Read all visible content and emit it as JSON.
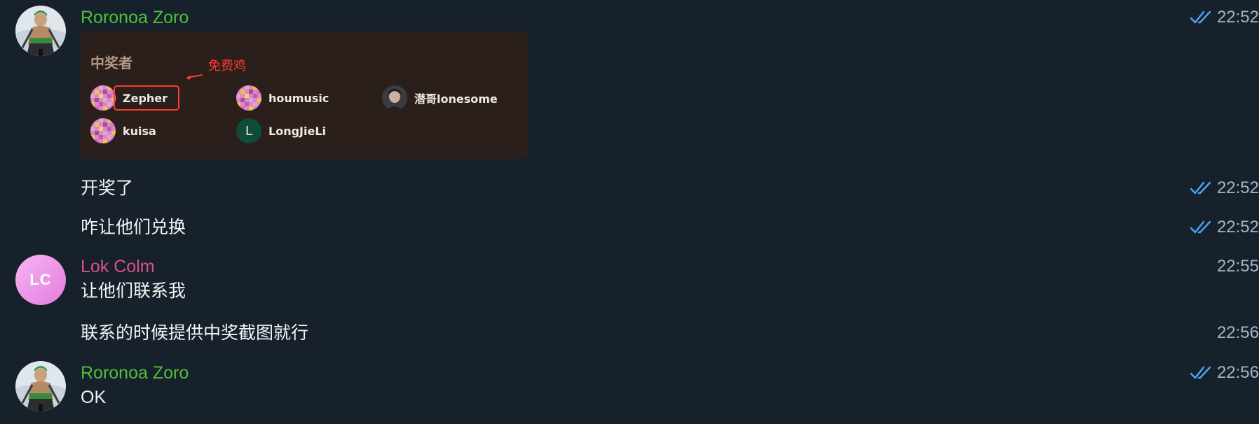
{
  "colors": {
    "background": "#17212b",
    "zoro_name": "#4fbf3c",
    "lok_name": "#d94f93",
    "message_text": "#f5f5f5",
    "time_text": "#a7b3bf",
    "read_ticks": "#4ea4f6",
    "annotation": "#ff3b2f"
  },
  "messages": [
    {
      "sender": "Roronoa Zoro",
      "time": "22:52",
      "read": true,
      "embed": {
        "title": "中奖者",
        "annotation": "免费鸡",
        "winners": [
          "Zepher",
          "houmusic",
          "潜哥lonesome",
          "kuisa",
          "LongJieLi"
        ],
        "letter_avatar": "L"
      }
    },
    {
      "text": "开奖了",
      "time": "22:52",
      "read": true
    },
    {
      "text": "咋让他们兑换",
      "time": "22:52",
      "read": true
    },
    {
      "sender": "Lok Colm",
      "avatar_initials": "LC",
      "text": "让他们联系我",
      "time": "22:55",
      "read": false
    },
    {
      "text": "联系的时候提供中奖截图就行",
      "time": "22:56",
      "read": false
    },
    {
      "sender": "Roronoa Zoro",
      "text": "OK",
      "time": "22:56",
      "read": true
    }
  ]
}
